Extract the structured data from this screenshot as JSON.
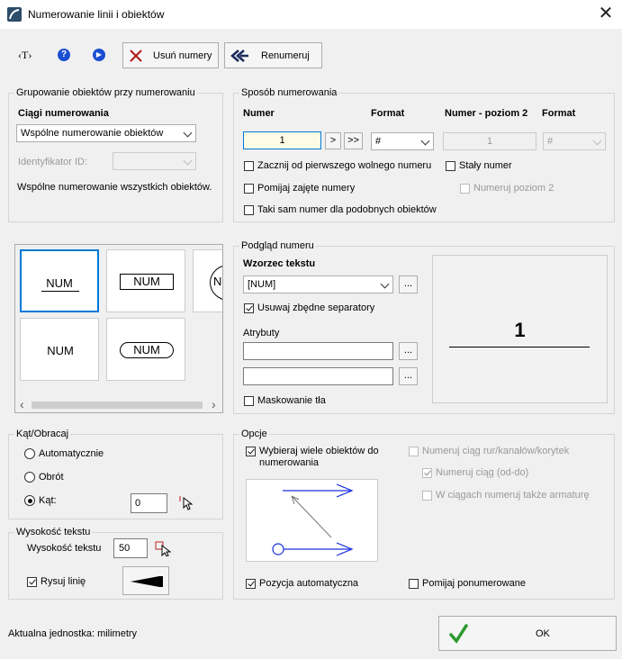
{
  "window": {
    "title": "Numerowanie linii i obiektów",
    "close": "✕"
  },
  "toolbar": {
    "text_style": "‹T›",
    "help": "?",
    "play": "▶",
    "delete_label": "Usuń numery",
    "renumber_label": "Renumeruj"
  },
  "grouping": {
    "title": "Grupowanie obiektów przy numerowaniu",
    "sequences_label": "Ciągi numerowania",
    "sequence_value": "Wspólne numerowanie obiektów",
    "id_label": "Identyfikator ID:",
    "description": "Wspólne numerowanie wszystkich obiektów."
  },
  "numbering": {
    "title": "Sposób numerowania",
    "number_label": "Numer",
    "format_label": "Format",
    "level2_label": "Numer - poziom 2",
    "format2_label": "Format",
    "number_value": "1",
    "next_btn": ">",
    "last_btn": ">>",
    "format_value": "#",
    "level2_value": "1",
    "format2_value": "#",
    "start_first_free": "Zacznij od pierwszego wolnego numeru",
    "fixed_number": "Stały numer",
    "skip_taken": "Pomijaj zajęte numery",
    "number_level2": "Numeruj poziom 2",
    "same_for_similar": "Taki sam numer dla podobnych obiektów"
  },
  "styles": {
    "tiles": [
      "NUM",
      "NUM",
      "NUM",
      "NUM",
      "NUM"
    ],
    "scroll_left": "‹",
    "scroll_right": "›"
  },
  "preview": {
    "title": "Podgląd numeru",
    "pattern_label": "Wzorzec tekstu",
    "pattern_value": "[NUM]",
    "browse": "...",
    "remove_separators": "Usuwaj zbędne separatory",
    "attributes_label": "Atrybuty",
    "mask_background": "Maskowanie tła",
    "preview_number": "1"
  },
  "angle": {
    "title": "Kąt/Obracaj",
    "automatic": "Automatycznie",
    "rotation": "Obrót",
    "angle_label": "Kąt:",
    "angle_value": "0"
  },
  "text_height": {
    "title": "Wysokość tekstu",
    "height_label": "Wysokość tekstu",
    "height_value": "50",
    "draw_line": "Rysuj linię"
  },
  "options": {
    "title": "Opcje",
    "select_multiple": "Wybieraj wiele obiektów do numerowania",
    "number_pipe_seq": "Numeruj ciąg rur/kanałów/korytek",
    "number_seq_from_to": "Numeruj ciąg (od-do)",
    "in_seq_fittings": "W ciągach numeruj także armaturę",
    "auto_position": "Pozycja automatyczna",
    "skip_numbered": "Pomijaj ponumerowane"
  },
  "footer": {
    "unit": "Aktualna jednostka: milimetry",
    "ok": "OK"
  },
  "colors": {
    "accent": "#0078d7",
    "help_blue": "#1a4fd1",
    "ok_green": "#2d9a2d",
    "arrow_blue": "#1a2fe0"
  }
}
